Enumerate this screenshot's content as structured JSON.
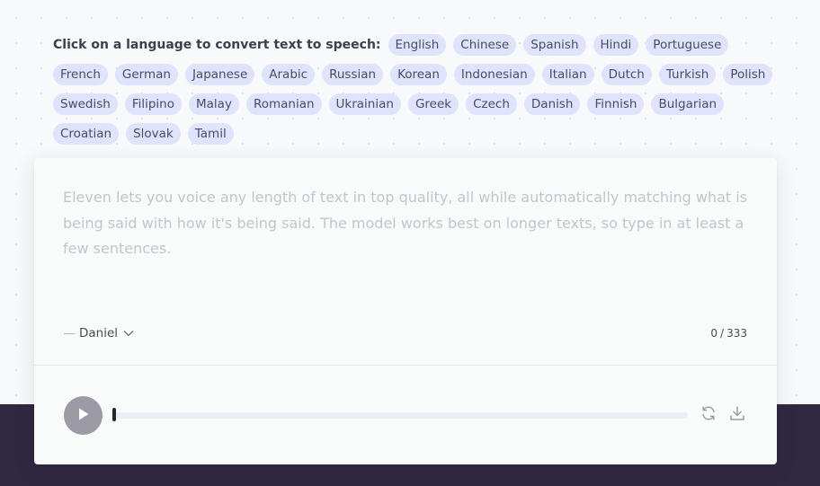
{
  "language_picker": {
    "prompt": "Click on a language to convert text to speech:",
    "languages": [
      "English",
      "Chinese",
      "Spanish",
      "Hindi",
      "Portuguese",
      "French",
      "German",
      "Japanese",
      "Arabic",
      "Russian",
      "Korean",
      "Indonesian",
      "Italian",
      "Dutch",
      "Turkish",
      "Polish",
      "Swedish",
      "Filipino",
      "Malay",
      "Romanian",
      "Ukrainian",
      "Greek",
      "Czech",
      "Danish",
      "Finnish",
      "Bulgarian",
      "Croatian",
      "Slovak",
      "Tamil"
    ]
  },
  "editor": {
    "placeholder": "Eleven lets you voice any length of text in top quality, all while automatically matching what is being said with how it's being said. The model works best on longer texts, so type in at least a few sentences.",
    "value": ""
  },
  "voice": {
    "selected": "Daniel"
  },
  "char_count": {
    "current": "0",
    "separator": "/",
    "max": "333"
  },
  "player": {
    "progress": 0
  },
  "icons": {
    "play": "play-icon",
    "regenerate": "refresh-icon",
    "download": "download-icon",
    "voice_dropdown": "chevron-down-icon"
  },
  "colors": {
    "chip_bg": "#dfe3fb",
    "dark_band": "#2f2840",
    "play_button": "#9c9aa4"
  }
}
